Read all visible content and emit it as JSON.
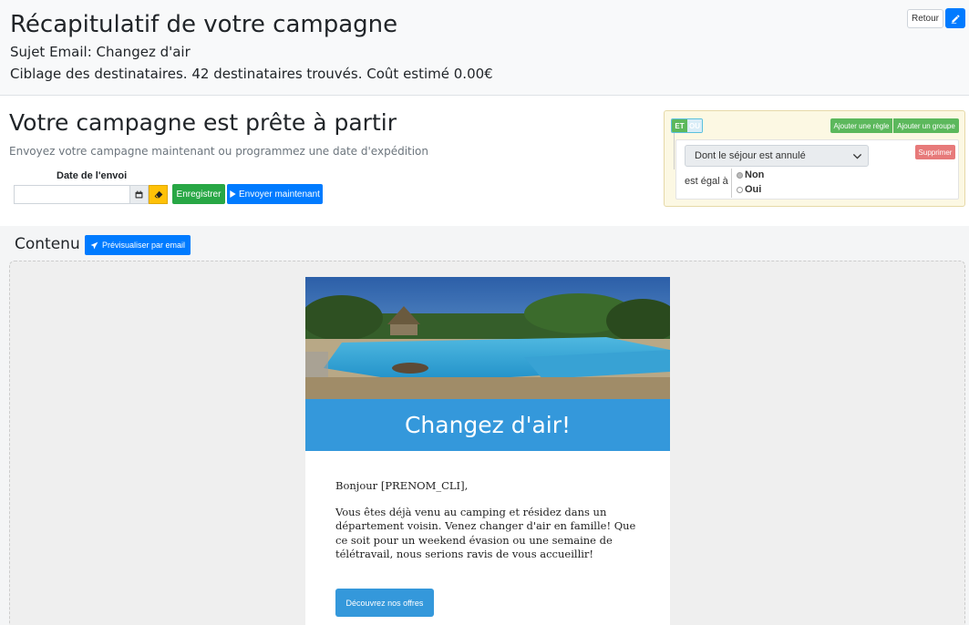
{
  "summary": {
    "title": "Récapitulatif de votre campagne",
    "subject_line": "Sujet Email: Changez d'air",
    "targeting_line": "Ciblage des destinataires. 42 destinataires trouvés. Coût estimé 0.00€",
    "back_label": "Retour"
  },
  "ready": {
    "title": "Votre campagne est prête à partir",
    "subtitle": "Envoyez votre campagne maintenant ou programmez une date d'expédition",
    "date_label": "Date de l'envoi",
    "date_value": "",
    "save_label": "Enregistrer",
    "send_label": "Envoyer maintenant"
  },
  "rules": {
    "and_label": "ET",
    "or_label": "OU",
    "add_rule_label": "Ajouter une règle",
    "add_group_label": "Ajouter un groupe",
    "field_selected": "Dont le séjour est annulé",
    "delete_label": "Supprimer",
    "operator_label": "est égal à",
    "options": [
      "Non",
      "Oui"
    ],
    "selected_option": "Non"
  },
  "content": {
    "title": "Contenu",
    "preview_label": "Prévisualiser par email"
  },
  "email": {
    "banner": "Changez d'air!",
    "greeting": "Bonjour [PRENOM_CLI],",
    "paragraph": "Vous êtes déjà venu au camping et résidez dans un département voisin. Venez changer d'air en famille! Que ce soit pour un weekend évasion ou une semaine de télétravail, nous serions ravis de vous accueillir!",
    "cta_label": "Découvrez nos offres"
  },
  "colors": {
    "primary": "#007bff",
    "success": "#28a745",
    "warning": "#ffc107",
    "danger": "#e77a7a",
    "email_accent": "#3498db",
    "rules_bg": "#fcf8e3"
  }
}
